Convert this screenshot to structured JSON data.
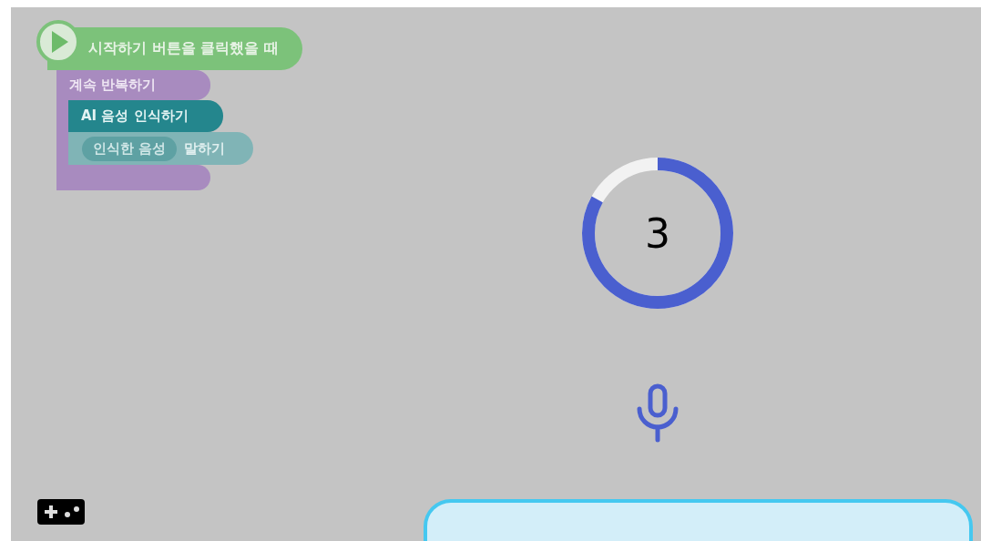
{
  "script": {
    "hat": {
      "kind": "event",
      "label": "시작하기 버튼을 클릭했을 때"
    },
    "blocks": [
      {
        "kind": "loop",
        "label": "계속 반복하기",
        "children": [
          {
            "kind": "ai",
            "parts": [
              {
                "kind": "text",
                "text": "AI 음성 인식하기"
              }
            ]
          },
          {
            "kind": "say",
            "parts": [
              {
                "kind": "reporter",
                "text": "인식한 음성"
              },
              {
                "kind": "text",
                "text": "말하기"
              }
            ]
          }
        ]
      }
    ]
  },
  "countdown": {
    "number": "3",
    "level": 0.83
  }
}
